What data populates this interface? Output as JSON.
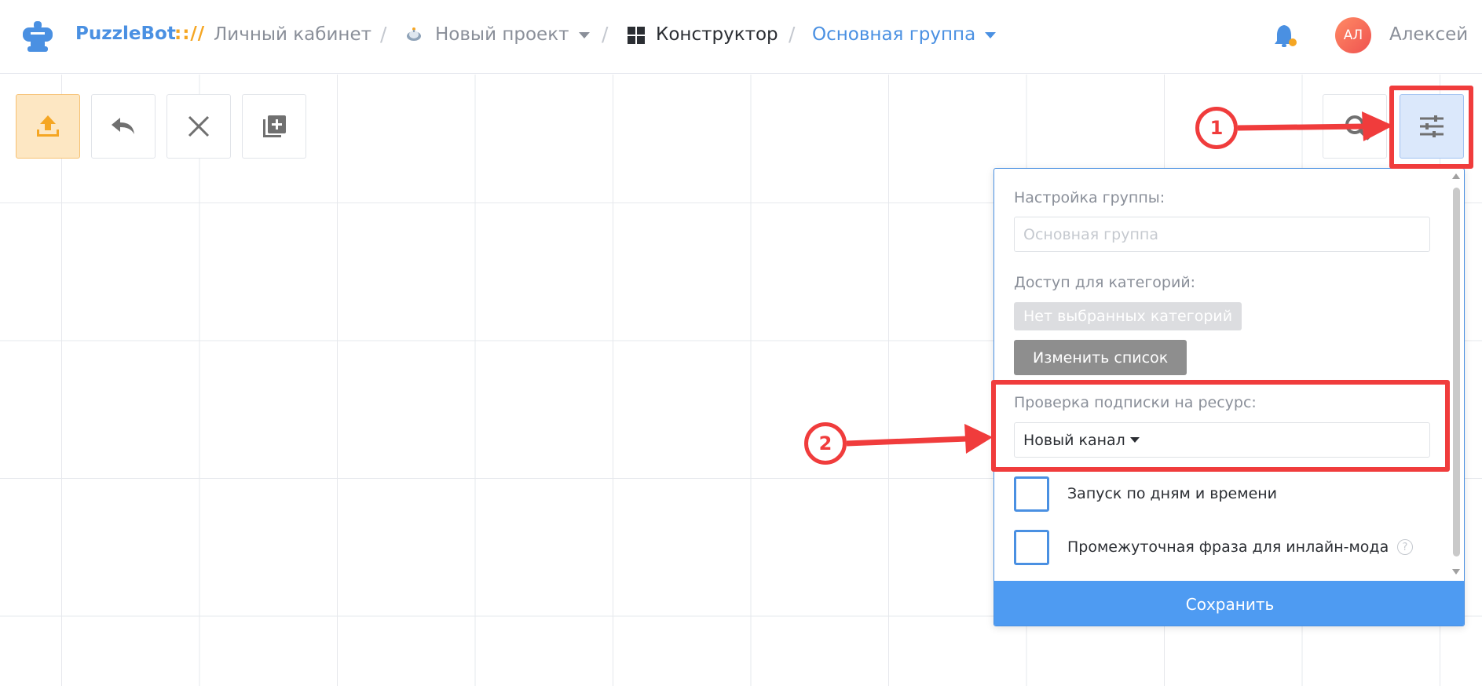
{
  "header": {
    "brand": "PuzzleBot",
    "brand_sep": ":://",
    "crumb_cabinet": "Личный кабинет",
    "crumb_project": "Новый проект",
    "crumb_constructor": "Конструктор",
    "crumb_group": "Основная группа",
    "avatar_initials": "АЛ",
    "user_name": "Алексей"
  },
  "panel": {
    "group_settings_label": "Настройка группы:",
    "group_name_placeholder": "Основная группа",
    "category_access_label": "Доступ для категорий:",
    "no_categories_chip": "Нет выбранных категорий",
    "change_list_button": "Изменить список",
    "subscription_check_label": "Проверка подписки на ресурс:",
    "subscription_select_value": "Новый канал",
    "checkbox_schedule_label": "Запуск по дням и времени",
    "checkbox_inline_label": "Промежуточная фраза для инлайн-мода",
    "help_glyph": "?",
    "save_button": "Сохранить"
  },
  "annotations": {
    "marker_1": "1",
    "marker_2": "2"
  },
  "colors": {
    "accent": "#4a90e2",
    "brand_orange": "#f5a623",
    "annotation_red": "#f03c3c",
    "save_blue": "#4e9bf2"
  },
  "icons": {
    "logo": "puzzlebot-logo-icon",
    "project": "robot-icon",
    "constructor": "grid-icon",
    "bell": "bell-icon",
    "upload": "upload-icon",
    "undo": "undo-icon",
    "close": "close-icon",
    "add": "add-copy-icon",
    "search": "search-icon",
    "settings": "sliders-icon"
  }
}
